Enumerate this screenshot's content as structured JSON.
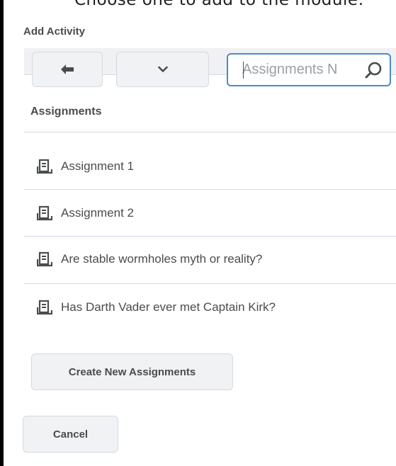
{
  "background_text": "Choose one to add to the module:",
  "dialog": {
    "title": "Add Activity"
  },
  "toolbar": {
    "back_icon": "arrow-left-icon",
    "menu_icon": "chevron-down-icon",
    "search": {
      "placeholder": "Assignments N",
      "icon": "search-icon"
    }
  },
  "section": {
    "heading": "Assignments"
  },
  "items": [
    {
      "label": "Assignment 1",
      "icon": "assignment-icon"
    },
    {
      "label": "Assignment 2",
      "icon": "assignment-icon"
    },
    {
      "label": "Are stable wormholes myth or reality?",
      "icon": "assignment-icon"
    },
    {
      "label": "Has Darth Vader ever met Captain Kirk?",
      "icon": "assignment-icon"
    }
  ],
  "buttons": {
    "create": "Create New Assignments",
    "cancel": "Cancel"
  },
  "colors": {
    "text": "#494c4e",
    "focus_border": "#4c8bc6",
    "button_bg": "#f1f2f4",
    "divider": "#d3d9e3",
    "link": "#006fbf"
  }
}
